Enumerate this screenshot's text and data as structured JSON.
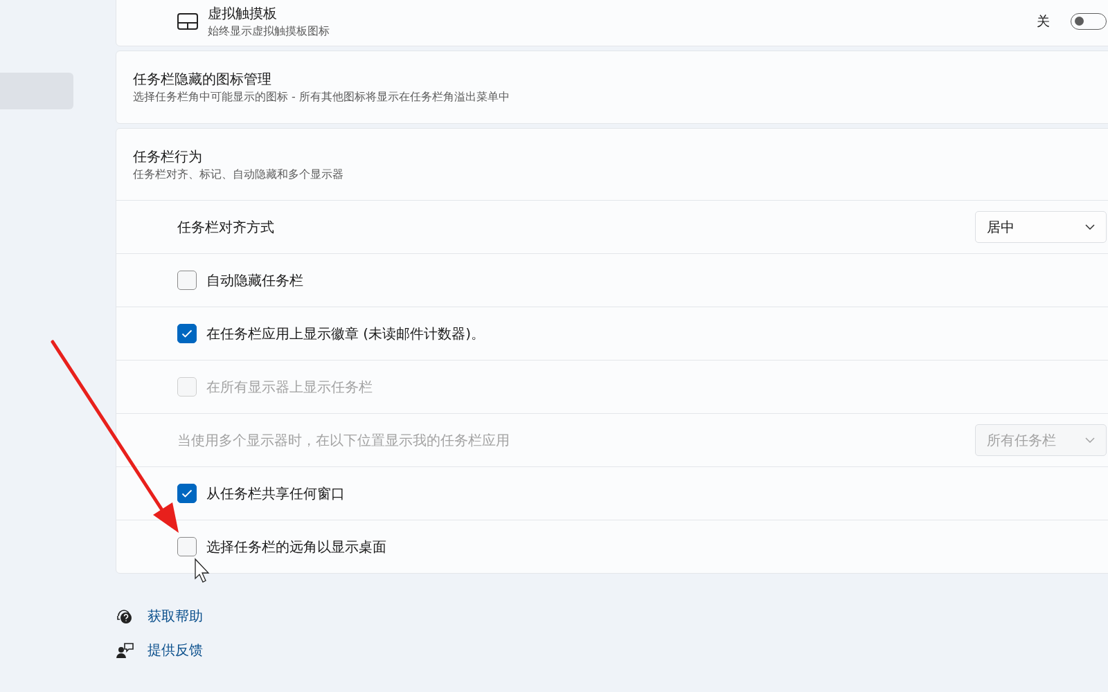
{
  "sidebar": {
    "items": [
      {
        "selected": true
      }
    ]
  },
  "touchpad_card": {
    "title": "虚拟触摸板",
    "subtitle": "始终显示虚拟触摸板图标",
    "toggle": {
      "label": "关",
      "on": false
    }
  },
  "hidden_icons_card": {
    "title": "任务栏隐藏的图标管理",
    "subtitle": "选择任务栏角中可能显示的图标 - 所有其他图标将显示在任务栏角溢出菜单中"
  },
  "behavior_card": {
    "title": "任务栏行为",
    "subtitle": "任务栏对齐、标记、自动隐藏和多个显示器",
    "rows": [
      {
        "kind": "dropdown",
        "label": "任务栏对齐方式",
        "value": "居中",
        "disabled": false
      },
      {
        "kind": "checkbox",
        "label": "自动隐藏任务栏",
        "checked": false,
        "disabled": false
      },
      {
        "kind": "checkbox",
        "label": "在任务栏应用上显示徽章 (未读邮件计数器)。",
        "checked": true,
        "disabled": false
      },
      {
        "kind": "checkbox",
        "label": "在所有显示器上显示任务栏",
        "checked": false,
        "disabled": true
      },
      {
        "kind": "dropdown",
        "label": "当使用多个显示器时，在以下位置显示我的任务栏应用",
        "value": "所有任务栏",
        "disabled": true
      },
      {
        "kind": "checkbox",
        "label": "从任务栏共享任何窗口",
        "checked": true,
        "disabled": false
      },
      {
        "kind": "checkbox",
        "label": "选择任务栏的远角以显示桌面",
        "checked": false,
        "disabled": false
      }
    ]
  },
  "links": [
    {
      "kind": "help",
      "label": "获取帮助"
    },
    {
      "kind": "feedback",
      "label": "提供反馈"
    }
  ]
}
